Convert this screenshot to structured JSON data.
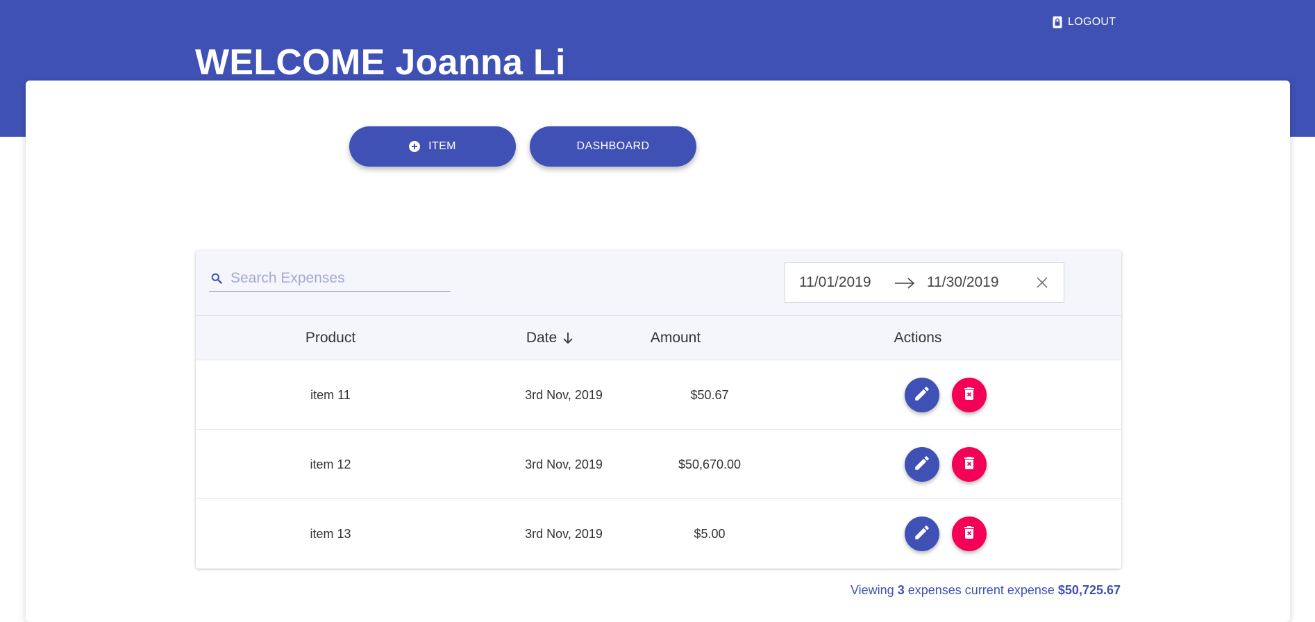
{
  "header": {
    "welcome_text": "WELCOME Joanna Li",
    "logout_label": "LOGOUT",
    "logout_icon": "lock-icon"
  },
  "actions": {
    "add_item_label": "ITEM",
    "add_item_icon": "plus-circle-icon",
    "dashboard_label": "DASHBOARD"
  },
  "search": {
    "placeholder": "Search Expenses",
    "value": ""
  },
  "date_range": {
    "start": "11/01/2019",
    "end": "11/30/2019"
  },
  "table": {
    "columns": {
      "product": "Product",
      "date": "Date",
      "amount": "Amount",
      "actions": "Actions"
    },
    "sort": {
      "column": "date",
      "direction": "desc"
    },
    "rows": [
      {
        "product": "item 11",
        "date": "3rd Nov, 2019",
        "amount": "$50.67"
      },
      {
        "product": "item 12",
        "date": "3rd Nov, 2019",
        "amount": "$50,670.00"
      },
      {
        "product": "item 13",
        "date": "3rd Nov, 2019",
        "amount": "$5.00"
      }
    ]
  },
  "footer": {
    "prefix": "Viewing",
    "count": "3",
    "middle": "expenses current expense",
    "total": "$50,725.67"
  },
  "colors": {
    "primary": "#3f51b5",
    "delete": "#f50057",
    "toolbar_bg": "#f5f6fc"
  }
}
